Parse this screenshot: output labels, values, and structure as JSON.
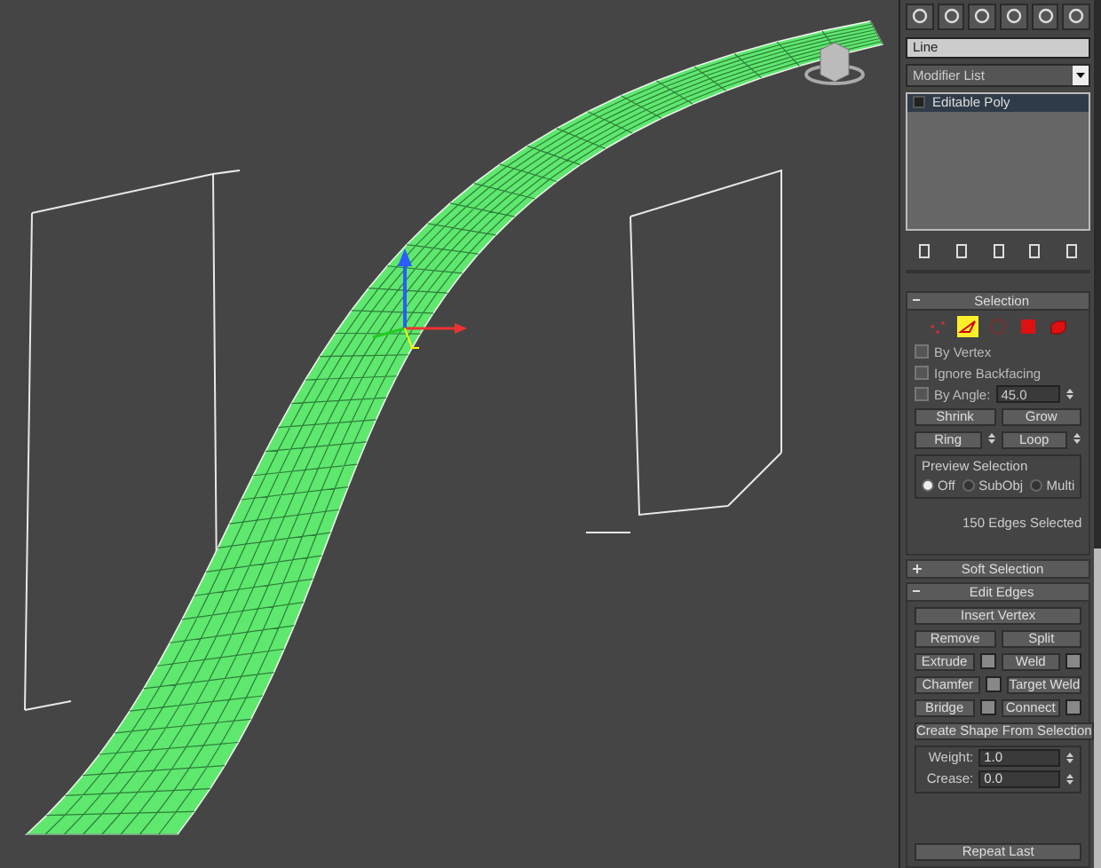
{
  "object_name": {
    "value": "Line"
  },
  "modifier_list": {
    "label": "Modifier List"
  },
  "modifier_stack": [
    {
      "name": "Editable Poly",
      "selected": true
    }
  ],
  "selection": {
    "title": "Selection",
    "expanded": true,
    "levels": [
      {
        "kind": "vertex",
        "selected": false
      },
      {
        "kind": "edge",
        "selected": true
      },
      {
        "kind": "border",
        "selected": false
      },
      {
        "kind": "polygon",
        "selected": false
      },
      {
        "kind": "element",
        "selected": false
      }
    ],
    "checkboxes": [
      {
        "label": "By Vertex",
        "checked": false
      },
      {
        "label": "Ignore Backfacing",
        "checked": false
      },
      {
        "label": "By Angle:",
        "checked": false,
        "value": "45.0"
      }
    ],
    "button_rows": [
      [
        {
          "label": "Shrink",
          "spinner": false
        },
        {
          "label": "Grow",
          "spinner": false
        }
      ],
      [
        {
          "label": "Ring",
          "spinner": true
        },
        {
          "label": "Loop",
          "spinner": true
        }
      ]
    ],
    "preview": {
      "title": "Preview Selection",
      "options": [
        {
          "label": "Off",
          "selected": true
        },
        {
          "label": "SubObj",
          "selected": false
        },
        {
          "label": "Multi",
          "selected": false
        }
      ]
    },
    "status": "150 Edges Selected"
  },
  "soft_selection": {
    "title": "Soft Selection",
    "expanded": false
  },
  "edit_edges": {
    "title": "Edit Edges",
    "expanded": true,
    "button_rows": [
      [
        {
          "label": "Insert Vertex",
          "settings": false
        }
      ],
      [
        {
          "label": "Remove",
          "settings": false
        },
        {
          "label": "Split",
          "settings": false
        }
      ],
      [
        {
          "label": "Extrude",
          "settings": true
        },
        {
          "label": "Weld",
          "settings": true
        }
      ],
      [
        {
          "label": "Chamfer",
          "settings": true
        },
        {
          "label": "Target Weld",
          "settings": false
        }
      ],
      [
        {
          "label": "Bridge",
          "settings": true
        },
        {
          "label": "Connect",
          "settings": true
        }
      ],
      [
        {
          "label": "Create Shape From Selection",
          "settings": false
        }
      ]
    ],
    "spinners": [
      {
        "label": "Weight:",
        "value": "1.0"
      },
      {
        "label": "Crease:",
        "value": "0.0"
      }
    ],
    "last_button": "Repeat Last"
  }
}
